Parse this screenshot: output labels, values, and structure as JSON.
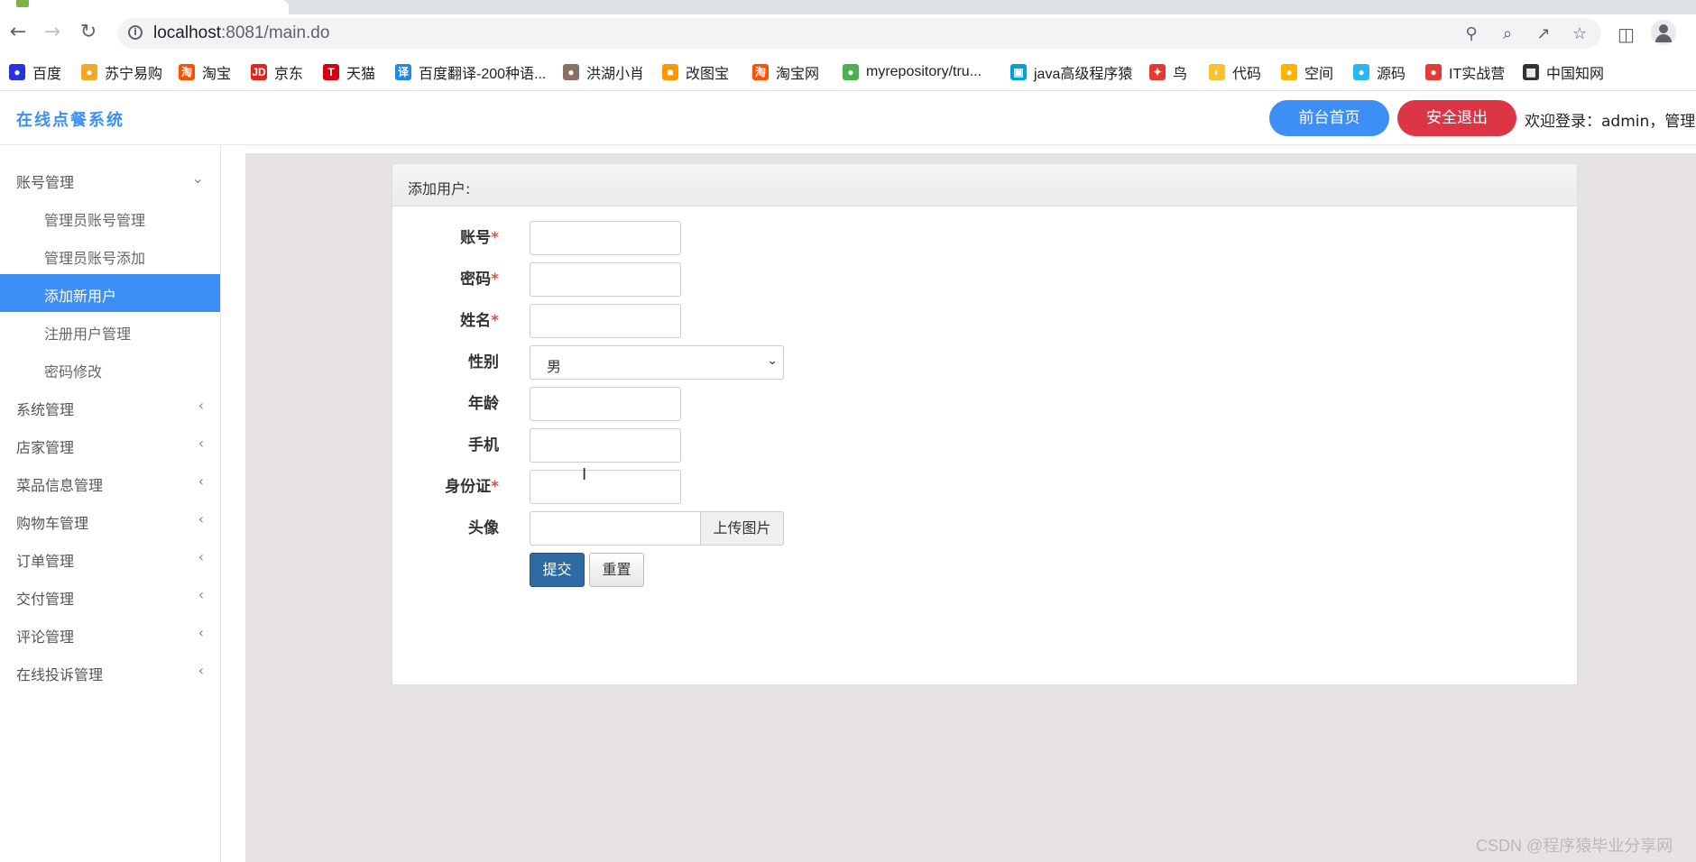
{
  "browser": {
    "url_host": "localhost",
    "url_path": ":8081/main.do",
    "bookmarks": [
      "百度",
      "苏宁易购",
      "淘宝",
      "京东",
      "天猫",
      "百度翻译-200种语...",
      "洪湖小肖",
      "改图宝",
      "淘宝网",
      "myrepository/tru...",
      "java高级程序猿",
      "鸟",
      "代码",
      "空间",
      "源码",
      "IT实战营",
      "中国知网"
    ],
    "bookmark_icon_colors": [
      "#2932e1",
      "#f5a623",
      "#ff5000",
      "#e1251b",
      "#d4000f",
      "#1e88e5",
      "#8d6e63",
      "#ff9800",
      "#ff5000",
      "#4caf50",
      "#00a1d6",
      "#e53935",
      "#fbc02d",
      "#ffb300",
      "#29b6f6",
      "#e53935",
      "#333333"
    ]
  },
  "header": {
    "brand": "在线点餐系统",
    "home_label": "前台首页",
    "logout_label": "安全退出",
    "welcome": "欢迎登录：admin，管理员"
  },
  "sidebar": {
    "group_account": "账号管理",
    "sub_items": [
      "管理员账号管理",
      "管理员账号添加",
      "添加新用户",
      "注册用户管理",
      "密码修改"
    ],
    "groups": [
      "系统管理",
      "店家管理",
      "菜品信息管理",
      "购物车管理",
      "订单管理",
      "交付管理",
      "评论管理",
      "在线投诉管理"
    ]
  },
  "form": {
    "title": "添加用户:",
    "label_account": "账号",
    "label_password": "密码",
    "label_name": "姓名",
    "label_gender": "性别",
    "gender_value": "男",
    "label_age": "年龄",
    "label_phone": "手机",
    "label_idcard": "身份证",
    "label_avatar": "头像",
    "required_mark": "*",
    "upload_label": "上传图片",
    "submit_label": "提交",
    "reset_label": "重置"
  },
  "watermark": "CSDN @程序猿毕业分享网",
  "colors": {
    "accent": "#3e8ef7",
    "danger": "#dc3545",
    "primary_dark": "#2d6ca2",
    "content_bg": "#e8e3e3"
  }
}
